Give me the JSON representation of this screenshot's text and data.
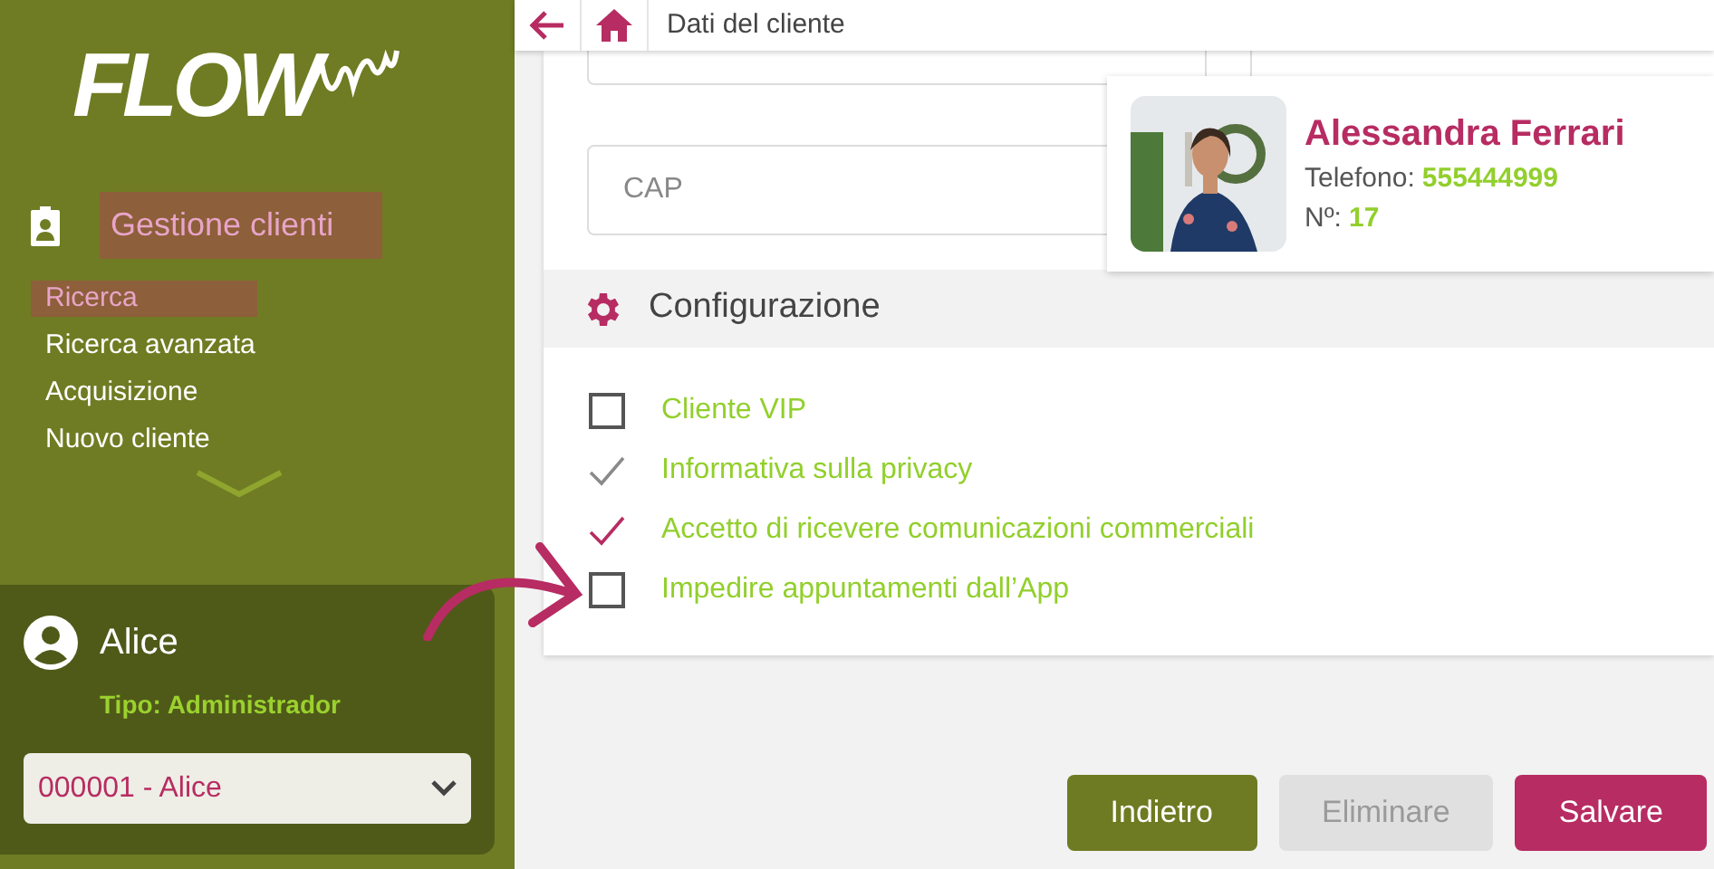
{
  "sidebar": {
    "logo": "FLOW",
    "menu": {
      "title": "Gestione clienti",
      "selected": true,
      "items": [
        {
          "label": "Ricerca",
          "selected": true
        },
        {
          "label": "Ricerca avanzata",
          "selected": false
        },
        {
          "label": "Acquisizione",
          "selected": false
        },
        {
          "label": "Nuovo cliente",
          "selected": false
        }
      ]
    },
    "user": {
      "name": "Alice",
      "role": "Tipo: Administrador",
      "select_value": "000001 - Alice"
    }
  },
  "topbar": {
    "title": "Dati del cliente"
  },
  "form": {
    "cap_placeholder": "CAP",
    "section_title": "Configurazione",
    "options": [
      {
        "label": "Cliente VIP",
        "checked": false,
        "disabled": false
      },
      {
        "label": "Informativa sulla privacy",
        "checked": true,
        "disabled": true
      },
      {
        "label": "Accetto di ricevere comunicazioni commerciali",
        "checked": true,
        "disabled": false
      },
      {
        "label": "Impedire appuntamenti dall’App",
        "checked": false,
        "disabled": false
      }
    ]
  },
  "client_card": {
    "name": "Alessandra Ferrari",
    "phone_label": "Telefono:",
    "phone": "555444999",
    "number_label": "Nº:",
    "number": "17"
  },
  "buttons": [
    {
      "label": "Indietro",
      "kind": "back",
      "disabled": false
    },
    {
      "label": "Eliminare",
      "kind": "delete",
      "disabled": true
    },
    {
      "label": "Salvare",
      "kind": "save",
      "disabled": false
    }
  ]
}
